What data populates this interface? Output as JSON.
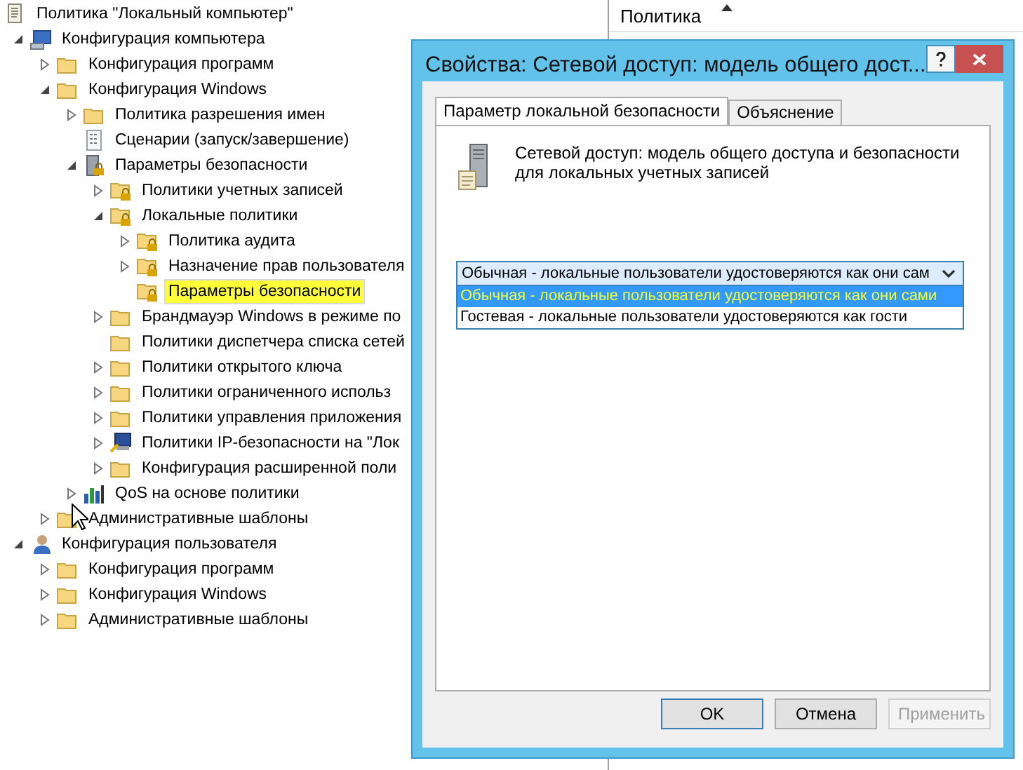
{
  "tree": [
    {
      "label": "Политика \"Локальный компьютер\"",
      "kind": "document",
      "selected": false,
      "children": [
        {
          "label": "Конфигурация компьютера",
          "kind": "computer",
          "expanded": true,
          "selected": false,
          "children": [
            {
              "label": "Конфигурация программ",
              "kind": "folder",
              "expanded": false,
              "selected": false
            },
            {
              "label": "Конфигурация Windows",
              "kind": "folder",
              "expanded": true,
              "selected": false,
              "children": [
                {
                  "label": "Политика разрешения имен",
                  "kind": "folder",
                  "expanded": false,
                  "selected": false
                },
                {
                  "label": "Сценарии (запуск/завершение)",
                  "kind": "script",
                  "selected": false
                },
                {
                  "label": "Параметры безопасности",
                  "kind": "security",
                  "expanded": true,
                  "selected": false,
                  "children": [
                    {
                      "label": "Политики учетных записей",
                      "kind": "lock-folder",
                      "expanded": false,
                      "selected": false
                    },
                    {
                      "label": "Локальные политики",
                      "kind": "lock-folder",
                      "expanded": true,
                      "selected": false,
                      "children": [
                        {
                          "label": "Политика аудита",
                          "kind": "lock-folder",
                          "expanded": false,
                          "selected": false
                        },
                        {
                          "label": "Назначение прав пользователя",
                          "kind": "lock-folder",
                          "expanded": false,
                          "selected": false
                        },
                        {
                          "label": "Параметры безопасности",
                          "kind": "lock-folder",
                          "selected": true
                        }
                      ]
                    },
                    {
                      "label": "Брандмауэр Windows в режиме по",
                      "kind": "folder",
                      "expanded": false,
                      "selected": false
                    },
                    {
                      "label": "Политики диспетчера списка сетей",
                      "kind": "folder",
                      "selected": false
                    },
                    {
                      "label": "Политики открытого ключа",
                      "kind": "folder",
                      "expanded": false,
                      "selected": false
                    },
                    {
                      "label": "Политики ограниченного использ",
                      "kind": "folder",
                      "expanded": false,
                      "selected": false
                    },
                    {
                      "label": "Политики управления приложения",
                      "kind": "folder",
                      "expanded": false,
                      "selected": false
                    },
                    {
                      "label": "Политики IP-безопасности на \"Лок",
                      "kind": "ip-security",
                      "expanded": false,
                      "selected": false
                    },
                    {
                      "label": "Конфигурация расширенной поли",
                      "kind": "folder",
                      "expanded": false,
                      "selected": false
                    }
                  ]
                },
                {
                  "label": "QoS на основе политики",
                  "kind": "qos",
                  "expanded": false,
                  "selected": false
                }
              ]
            },
            {
              "label": "Административные шаблоны",
              "kind": "folder",
              "expanded": false,
              "selected": false
            }
          ]
        },
        {
          "label": "Конфигурация пользователя",
          "kind": "user",
          "expanded": true,
          "selected": false,
          "children": [
            {
              "label": "Конфигурация программ",
              "kind": "folder",
              "expanded": false,
              "selected": false
            },
            {
              "label": "Конфигурация Windows",
              "kind": "folder",
              "expanded": false,
              "selected": false
            },
            {
              "label": "Административные шаблоны",
              "kind": "folder",
              "expanded": false,
              "selected": false
            }
          ]
        }
      ]
    }
  ],
  "policy_list": {
    "column": "Политика"
  },
  "dialog": {
    "title": "Свойства: Сетевой доступ: модель общего дост...",
    "tabs": [
      {
        "label": "Параметр локальной безопасности",
        "selected": true
      },
      {
        "label": "Объяснение",
        "selected": false
      }
    ],
    "description": "Сетевой доступ: модель общего доступа и безопасности для локальных учетных записей",
    "combobox": {
      "value": "Обычная - локальные пользователи удостоверяются как они сам",
      "expanded": true,
      "options": [
        {
          "label": "Обычная - локальные пользователи удостоверяются как они сами",
          "selected": true
        },
        {
          "label": "Гостевая - локальные пользователи удостоверяются как гости",
          "selected": false
        }
      ]
    },
    "buttons": [
      {
        "label": "OK",
        "kind": "default",
        "disabled": false
      },
      {
        "label": "Отмена",
        "kind": "normal",
        "disabled": false
      },
      {
        "label": "Применить",
        "kind": "normal",
        "disabled": true
      }
    ]
  }
}
